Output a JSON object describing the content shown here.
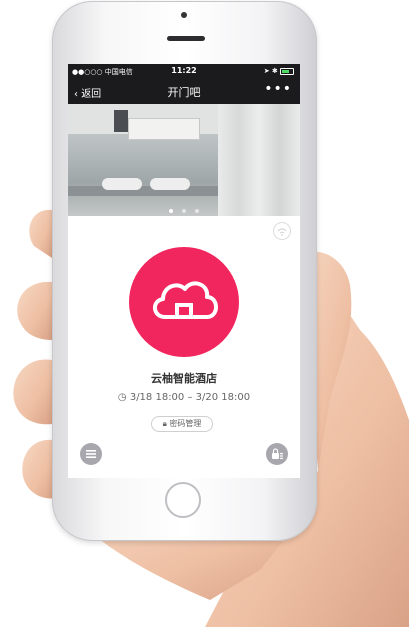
{
  "status_bar": {
    "carrier": "●●○○○ 中国电信",
    "time": "11:22"
  },
  "nav": {
    "back_label": "返回",
    "title": "开门吧",
    "more_label": "•••"
  },
  "banner": {
    "page_count": 3,
    "active_index": 0
  },
  "main": {
    "hotel_name": "云柚智能酒店",
    "stay_range": "3/18 18:00 – 3/20 18:00",
    "password_button_label": "密码管理"
  },
  "icons": [
    "chevron-left-icon",
    "more-icon",
    "wifi-icon",
    "cloud-icon",
    "clock-icon",
    "lock-icon",
    "menu-icon",
    "lock-list-icon"
  ],
  "colors": {
    "accent": "#f2265f",
    "nav_bg": "#1b1b1d"
  }
}
